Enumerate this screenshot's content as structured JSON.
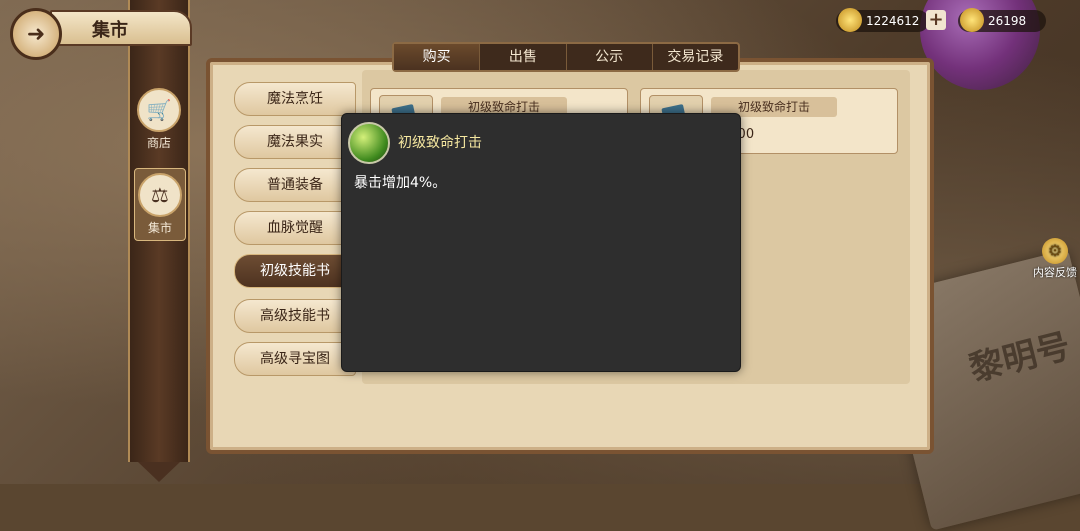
{
  "header": {
    "title": "集市",
    "back_icon": "back-arrow-icon"
  },
  "currency": {
    "gold": "1224612",
    "gems": "26198"
  },
  "sidebar": {
    "items": [
      {
        "label": "商店",
        "icon": "cart-icon"
      },
      {
        "label": "集市",
        "icon": "scales-icon"
      }
    ]
  },
  "tabs": [
    "购买",
    "出售",
    "公示",
    "交易记录"
  ],
  "active_tab": "购买",
  "categories": [
    "魔法烹饪",
    "魔法果实",
    "普通装备",
    "血脉觉醒",
    "初级技能书",
    "高级技能书",
    "高级寻宝图"
  ],
  "active_category": "初级技能书",
  "listings": [
    {
      "name": "初级致命打击",
      "price": ""
    },
    {
      "name": "初级致命打击",
      "price": "5000"
    }
  ],
  "tooltip": {
    "name": "初级致命打击",
    "description": "暴击增加4%。"
  },
  "feedback": {
    "label": "内容反馈"
  },
  "background": {
    "book_title": "黎明号"
  }
}
